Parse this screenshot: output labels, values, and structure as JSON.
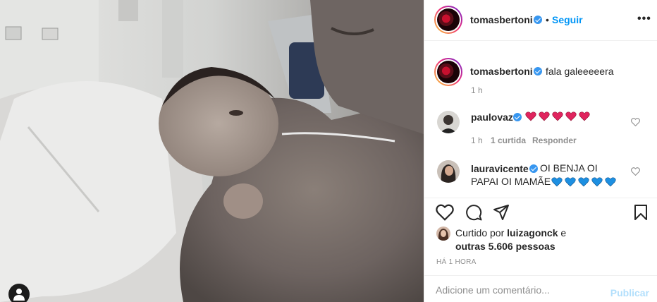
{
  "post": {
    "author": "tomasbertoni",
    "follow_label": "Seguir",
    "more_label": "•••",
    "separator": "•"
  },
  "caption": {
    "author": "tomasbertoni",
    "text": "fala galeeeeera",
    "time": "1 h"
  },
  "comments": [
    {
      "author": "paulovaz",
      "text": "",
      "hearts": 5,
      "heart_color": "#e0245e",
      "time": "1 h",
      "likes": "1 curtida",
      "reply": "Responder"
    },
    {
      "author": "lauravicente",
      "text_line1": "OI BENJA OI",
      "text_line2": "PAPAI OI MAMÃE",
      "hearts": 5,
      "heart_color": "#1d8fe1"
    }
  ],
  "likes": {
    "prefix": "Curtido por",
    "user": "luizagonck",
    "suffix": "e",
    "others": "outras 5.606 pessoas"
  },
  "post_time": "HÁ 1 HORA",
  "comment_input": {
    "placeholder": "Adicione um comentário...",
    "publish_label": "Publicar"
  },
  "colors": {
    "accent": "#0095f6",
    "verified": "#3897f0",
    "muted": "#8e8e8e",
    "publish_disabled": "#b2dffc"
  },
  "icons": [
    "heart-icon",
    "comment-icon",
    "share-icon",
    "bookmark-icon",
    "user-tag-icon",
    "verified-icon",
    "more-options-icon"
  ]
}
